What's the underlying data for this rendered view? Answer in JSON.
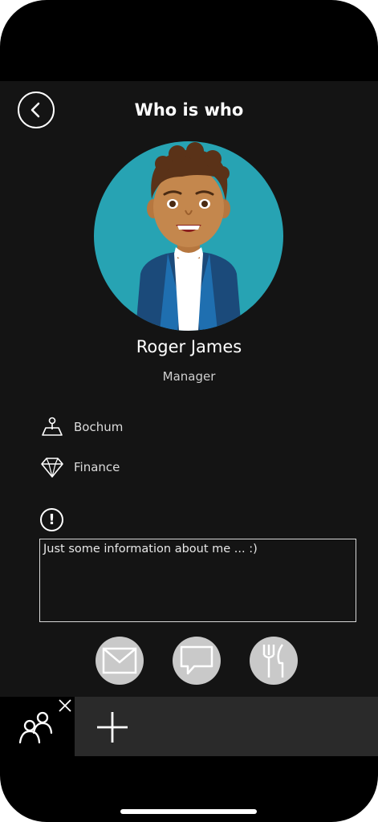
{
  "header": {
    "title": "Who is who"
  },
  "profile": {
    "name": "Roger James",
    "role": "Manager",
    "location": "Bochum",
    "department": "Finance",
    "about": "Just some information about me ... :)"
  },
  "icons": {
    "back": "chevron-left-icon",
    "location": "map-pin-icon",
    "department": "diamond-icon",
    "info": "exclamation-circle-icon",
    "mail": "mail-icon",
    "chat": "chat-bubble-icon",
    "lunch": "fork-knife-icon",
    "people": "people-icon",
    "close": "close-icon",
    "add": "plus-icon"
  },
  "colors": {
    "background": "#141414",
    "avatar_bg": "#27a3b3",
    "action_bg": "#c9c9c9",
    "bottom_bar": "#2a2a2a"
  }
}
